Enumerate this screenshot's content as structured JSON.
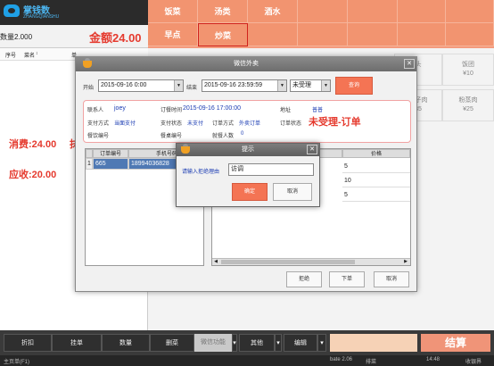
{
  "app": {
    "logo_text": "掌钱数",
    "logo_sub": "ZHANGQIANSHU"
  },
  "order": {
    "qty_label": "数量2.000",
    "amount_label": "金额24.00"
  },
  "list_header": [
    "序号",
    "菜名",
    "单"
  ],
  "left_totals": {
    "consumption": "消费:24.00",
    "payable": "应收:20.00",
    "extra": "抹"
  },
  "categories": [
    "饭菜",
    "汤类",
    "酒水",
    "",
    "",
    "",
    "早点",
    "炒菜",
    "",
    "",
    "",
    ""
  ],
  "active_category": "炒菜",
  "dishes": [
    {
      "name": "头",
      "price": ""
    },
    {
      "name": "饭团",
      "price": "¥10"
    },
    {
      "name": "粥子肉",
      "price": "35"
    },
    {
      "name": "粉蒸肉",
      "price": "¥25"
    }
  ],
  "toolbar": {
    "buttons": [
      "折扣",
      "挂单",
      "数量",
      "删菜",
      "微信功能",
      "其他",
      "编辑",
      "",
      "结算"
    ]
  },
  "statusbar": {
    "left": "主页单(F1)",
    "version": "bate 2.06",
    "user": "排菜",
    "time": "14:48",
    "right": "收银界"
  },
  "dialog": {
    "title": "微信外卖",
    "start_label": "开始",
    "start_value": "2015-09-16 0:00",
    "end_label": "结束",
    "end_value": "2015-09-16 23:59:59",
    "status_value": "未受理",
    "query_button": "查询",
    "info": {
      "contact_label": "联系人",
      "contact_value": "joey",
      "order_time_label": "订餐时间",
      "order_time_value": "2015-09-16 17:00:00",
      "address_label": "地址",
      "address_value": "普普",
      "pay_method_label": "支付方式",
      "pay_method_value": "当面支付",
      "pay_status_label": "支付状态",
      "pay_status_value": "未支付",
      "order_type_label": "订单方式",
      "order_type_value": "外卖订单",
      "order_status_label": "订单状态",
      "order_status_value": "未受理-订单",
      "remark_label": "餐饮编号",
      "table_no_label": "餐桌编号",
      "guests_label": "就餐人数",
      "guests_value": "0"
    },
    "left_table": {
      "headers": [
        "订单编号",
        "手机号码"
      ],
      "rows": [
        {
          "idx": "1",
          "order": "665",
          "phone": "18994036828"
        }
      ]
    },
    "right_table": {
      "headers": [
        "菜品数量",
        "价格"
      ],
      "rows": [
        [
          "",
          "5"
        ],
        [
          "",
          "10"
        ],
        [
          "",
          "5"
        ]
      ]
    },
    "buttons": {
      "reject": "拒绝",
      "place": "下单",
      "cancel": "取消"
    }
  },
  "prompt": {
    "title": "提示",
    "label": "请输入拒绝理由",
    "input_value": "访调",
    "ok": "确定",
    "cancel": "取消"
  }
}
